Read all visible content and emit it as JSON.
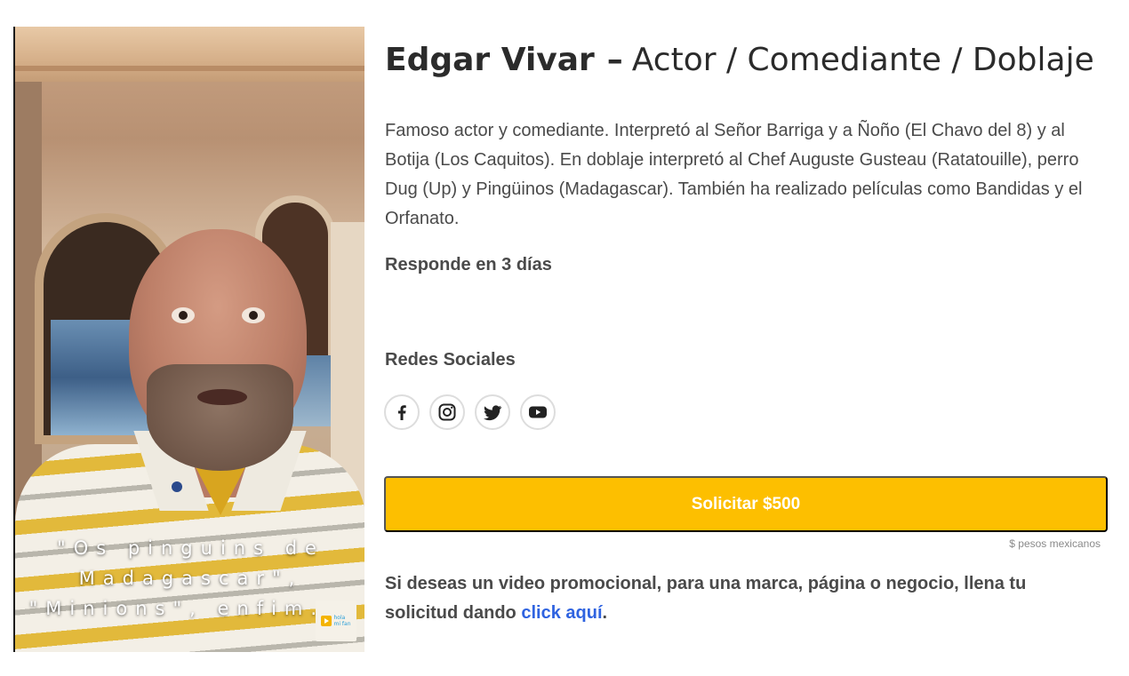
{
  "profile": {
    "name": "Edgar Vivar",
    "separator": "–",
    "role": "Actor / Comediante / Doblaje",
    "description": "Famoso actor y comediante. Interpretó al Señor Barriga y a Ñoño (El Chavo del 8) y al Botija (Los Caquitos). En doblaje interpretó al Chef Auguste Gusteau (Ratatouille), perro Dug (Up) y Pingüinos (Madagascar). También ha realizado películas como Bandidas y el Orfanato.",
    "response_time": "Responde en 3 días"
  },
  "video": {
    "caption": "\"Os pinguins de Madagascar\", \"Minions\", enfim...",
    "logo_lines": [
      "hola",
      "mi fan"
    ]
  },
  "social": {
    "heading": "Redes Sociales",
    "items": [
      {
        "icon": "facebook-icon"
      },
      {
        "icon": "instagram-icon"
      },
      {
        "icon": "twitter-icon"
      },
      {
        "icon": "youtube-icon"
      }
    ]
  },
  "cta": {
    "label": "Solicitar $500",
    "currency_note": "$ pesos mexicanos"
  },
  "promo": {
    "text": "Si deseas un video promocional, para una marca, página o negocio, llena tu solicitud dando ",
    "link_text": "click aquí",
    "suffix": "."
  },
  "colors": {
    "accent": "#fdbf00",
    "link": "#2f63e0",
    "text": "#4a4a4a"
  }
}
